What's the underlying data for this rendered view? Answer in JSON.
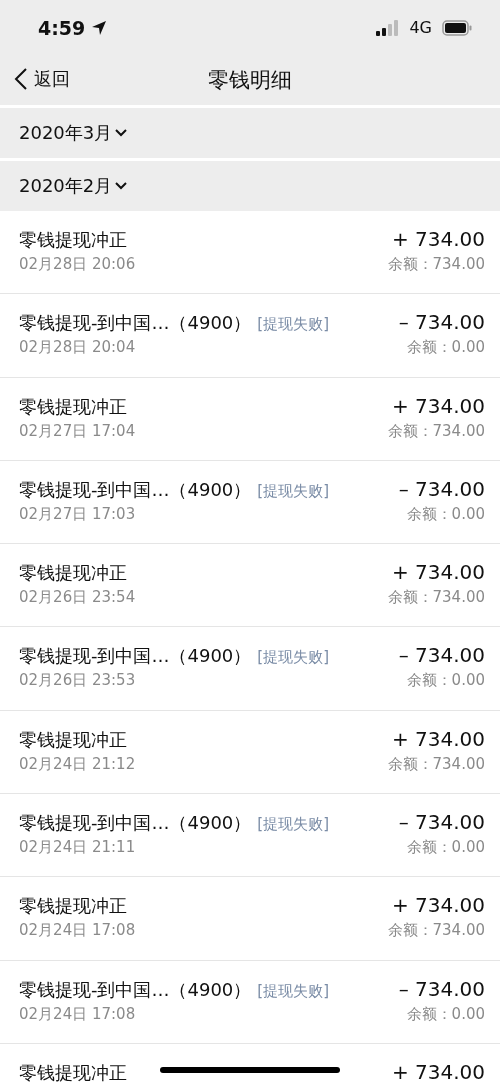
{
  "status_bar": {
    "time": "4:59",
    "network": "4G"
  },
  "nav": {
    "back": "返回",
    "title": "零钱明细"
  },
  "months": [
    {
      "label": "2020年3月"
    },
    {
      "label": "2020年2月",
      "rows": [
        {
          "title": "零钱提现冲正",
          "date": "02月28日 20:06",
          "amount": "+ 734.00",
          "balance": "余额：734.00"
        },
        {
          "title": "零钱提现-到中国…（4900）",
          "tag": "[提现失败]",
          "date": "02月28日 20:04",
          "amount": "– 734.00",
          "balance": "余额：0.00"
        },
        {
          "title": "零钱提现冲正",
          "date": "02月27日 17:04",
          "amount": "+ 734.00",
          "balance": "余额：734.00"
        },
        {
          "title": "零钱提现-到中国…（4900）",
          "tag": "[提现失败]",
          "date": "02月27日 17:03",
          "amount": "– 734.00",
          "balance": "余额：0.00"
        },
        {
          "title": "零钱提现冲正",
          "date": "02月26日 23:54",
          "amount": "+ 734.00",
          "balance": "余额：734.00"
        },
        {
          "title": "零钱提现-到中国…（4900）",
          "tag": "[提现失败]",
          "date": "02月26日 23:53",
          "amount": "– 734.00",
          "balance": "余额：0.00"
        },
        {
          "title": "零钱提现冲正",
          "date": "02月24日 21:12",
          "amount": "+ 734.00",
          "balance": "余额：734.00"
        },
        {
          "title": "零钱提现-到中国…（4900）",
          "tag": "[提现失败]",
          "date": "02月24日 21:11",
          "amount": "– 734.00",
          "balance": "余额：0.00"
        },
        {
          "title": "零钱提现冲正",
          "date": "02月24日 17:08",
          "amount": "+ 734.00",
          "balance": "余额：734.00"
        },
        {
          "title": "零钱提现-到中国…（4900）",
          "tag": "[提现失败]",
          "date": "02月24日 17:08",
          "amount": "– 734.00",
          "balance": "余额：0.00"
        },
        {
          "title": "零钱提现冲正",
          "amount": "+ 734.00"
        }
      ]
    }
  ]
}
